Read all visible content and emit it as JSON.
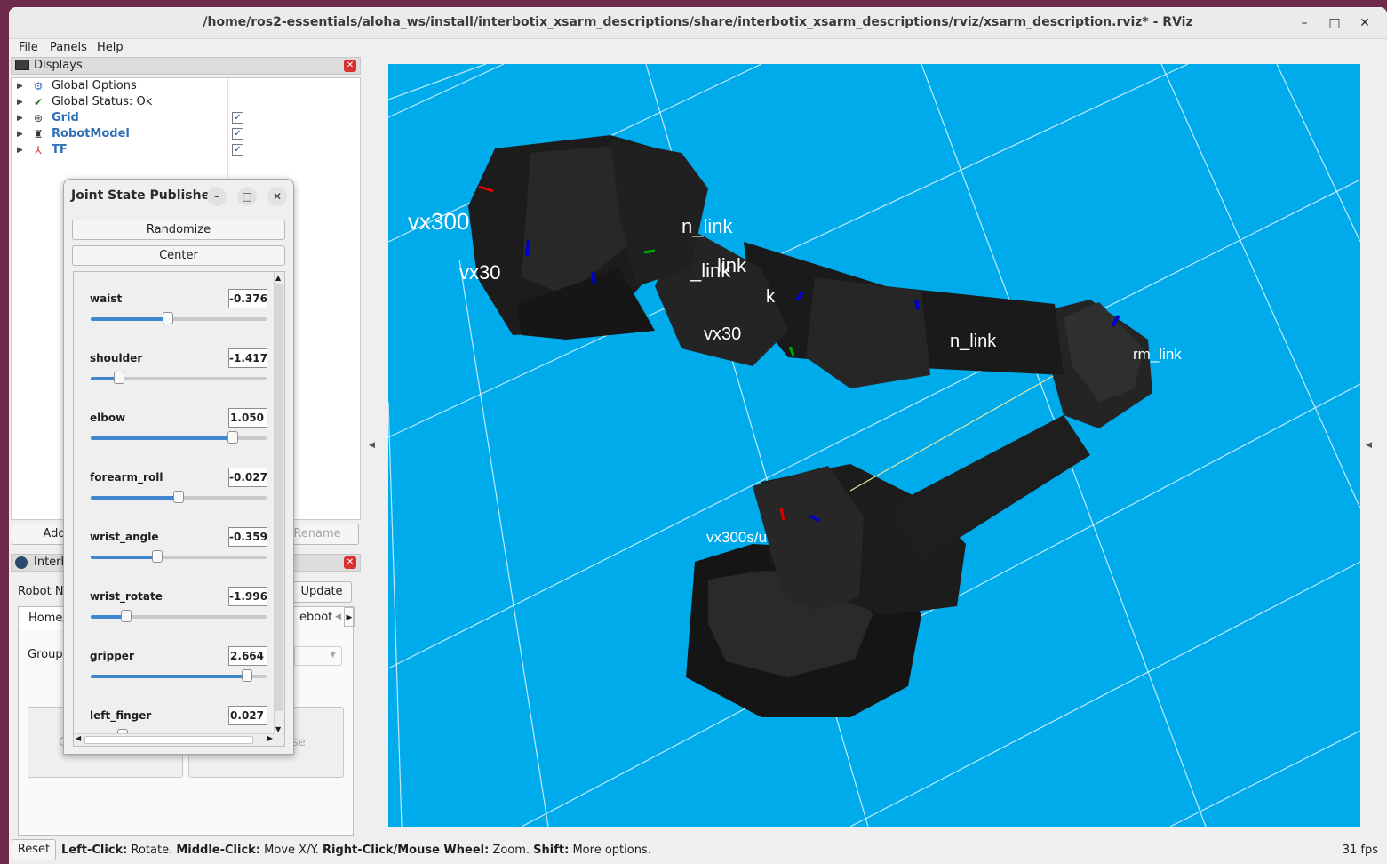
{
  "window": {
    "title": "/home/ros2-essentials/aloha_ws/install/interbotix_xsarm_descriptions/share/interbotix_xsarm_descriptions/rviz/xsarm_description.rviz* - RViz",
    "minimize": "–",
    "maximize": "□",
    "close": "✕"
  },
  "menu": [
    "File",
    "Panels",
    "Help"
  ],
  "displays": {
    "title": "Displays",
    "items": [
      {
        "label": "Global Options",
        "icon": "gear-icon",
        "checked": null
      },
      {
        "label": "Global Status: Ok",
        "icon": "checkmark-icon",
        "checked": null
      },
      {
        "label": "Grid",
        "icon": "grid-icon",
        "checked": true
      },
      {
        "label": "RobotModel",
        "icon": "robot-icon",
        "checked": true
      },
      {
        "label": "TF",
        "icon": "axes-icon",
        "checked": true
      }
    ],
    "add_label": "Add",
    "rename_label": "Rename"
  },
  "interbotix": {
    "title": "Interb",
    "robot_name_label": "Robot Na",
    "update_label": "Update",
    "tab_home": "Home/",
    "tab_reboot": "eboot",
    "group_label": "Group",
    "left_box_text": "C",
    "right_box_text": "ose"
  },
  "jsp": {
    "title": "Joint State Publisher",
    "randomize": "Randomize",
    "center": "Center",
    "joints": [
      {
        "name": "waist",
        "value": "-0.376",
        "pos": 0.44
      },
      {
        "name": "shoulder",
        "value": "-1.417",
        "pos": 0.16
      },
      {
        "name": "elbow",
        "value": "1.050",
        "pos": 0.81
      },
      {
        "name": "forearm_roll",
        "value": "-0.027",
        "pos": 0.5
      },
      {
        "name": "wrist_angle",
        "value": "-0.359",
        "pos": 0.38
      },
      {
        "name": "wrist_rotate",
        "value": "-1.996",
        "pos": 0.2
      },
      {
        "name": "gripper",
        "value": "2.664",
        "pos": 0.89
      },
      {
        "name": "left_finger",
        "value": "0.027",
        "pos": 0.18
      }
    ]
  },
  "viewport": {
    "background": "#00abec",
    "labels": [
      "vx300",
      "vx30",
      "n_link",
      "k",
      "vx30",
      "n_link",
      "rm_link",
      "vx300s/u",
      "_link",
      "link"
    ]
  },
  "status": {
    "reset": "Reset",
    "lc_b": "Left-Click:",
    "lc_t": " Rotate. ",
    "mc_b": "Middle-Click:",
    "mc_t": " Move X/Y. ",
    "rc_b": "Right-Click/Mouse Wheel:",
    "rc_t": " Zoom. ",
    "sh_b": "Shift:",
    "sh_t": " More options.",
    "fps": "31 fps"
  }
}
